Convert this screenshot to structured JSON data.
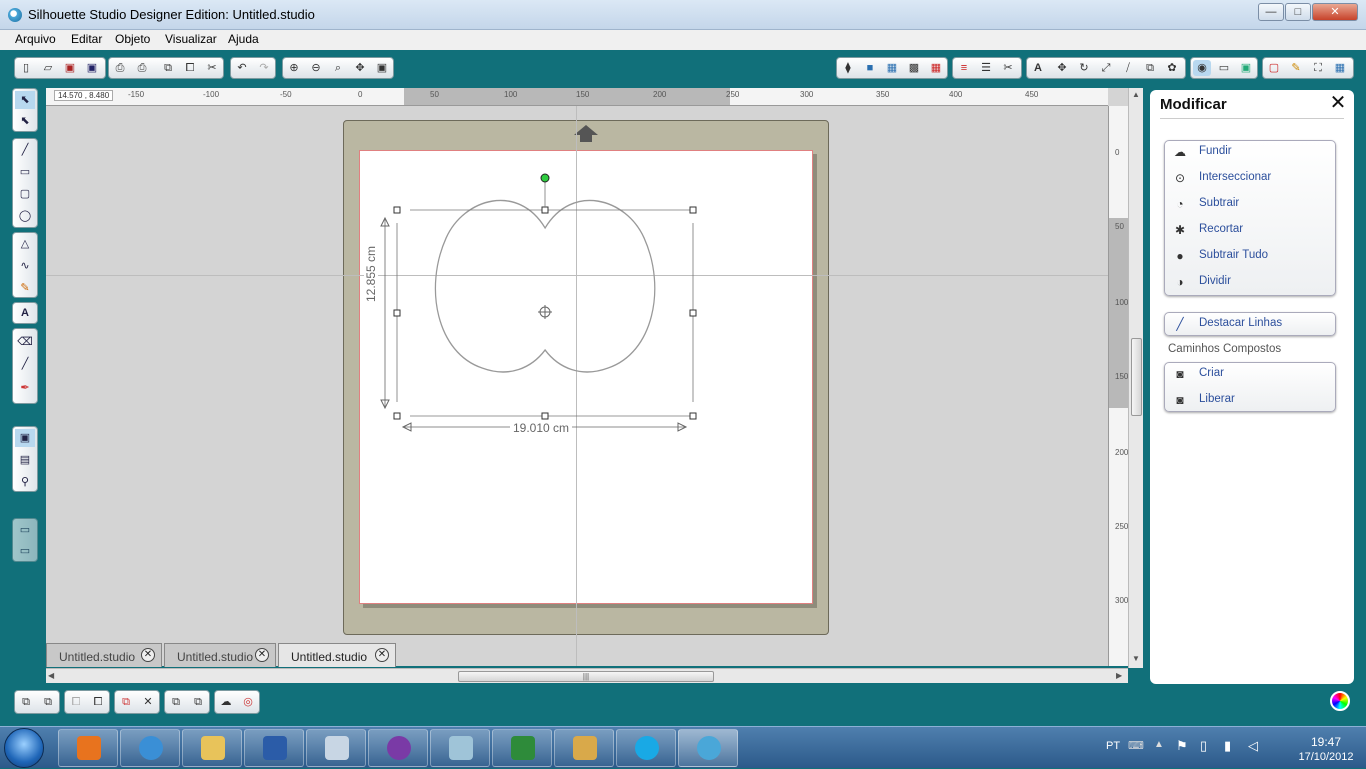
{
  "window": {
    "title": "Silhouette Studio Designer Edition: Untitled.studio",
    "min": "—",
    "max": "□",
    "close": "✕"
  },
  "menu": [
    "Arquivo",
    "Editar",
    "Objeto",
    "Visualizar",
    "Ajuda"
  ],
  "ruler": {
    "coords": "14.570 , 8.480",
    "h_ticks": [
      "-150",
      "-100",
      "-50",
      "0",
      "50",
      "100",
      "150",
      "200",
      "250",
      "300",
      "350",
      "400",
      "450"
    ],
    "v_ticks": [
      "0",
      "50",
      "100",
      "150",
      "200",
      "250",
      "300"
    ]
  },
  "selection": {
    "height_label": "12.855 cm",
    "width_label": "19.010 cm"
  },
  "tabs": [
    {
      "label": "Untitled.studio",
      "active": false
    },
    {
      "label": "Untitled.studio",
      "active": false
    },
    {
      "label": "Untitled.studio",
      "active": true
    }
  ],
  "panel": {
    "title": "Modificar",
    "close": "✕",
    "modify_items": [
      {
        "label": "Fundir",
        "icon": "weld-icon"
      },
      {
        "label": "Interseccionar",
        "icon": "intersect-icon"
      },
      {
        "label": "Subtrair",
        "icon": "subtract-icon"
      },
      {
        "label": "Recortar",
        "icon": "crop-icon"
      },
      {
        "label": "Subtrair Tudo",
        "icon": "subtract-all-icon"
      },
      {
        "label": "Dividir",
        "icon": "divide-icon"
      }
    ],
    "highlight": "Destacar Linhas",
    "compound_title": "Caminhos Compostos",
    "compound_items": [
      {
        "label": "Criar",
        "icon": "make-compound-icon"
      },
      {
        "label": "Liberar",
        "icon": "release-compound-icon"
      }
    ]
  },
  "taskbar": {
    "lang": "PT",
    "time": "19:47",
    "date": "17/10/2012"
  },
  "colors": {
    "accent": "#11707a",
    "mat": "#bab7a2",
    "link": "#2c4f9c"
  }
}
